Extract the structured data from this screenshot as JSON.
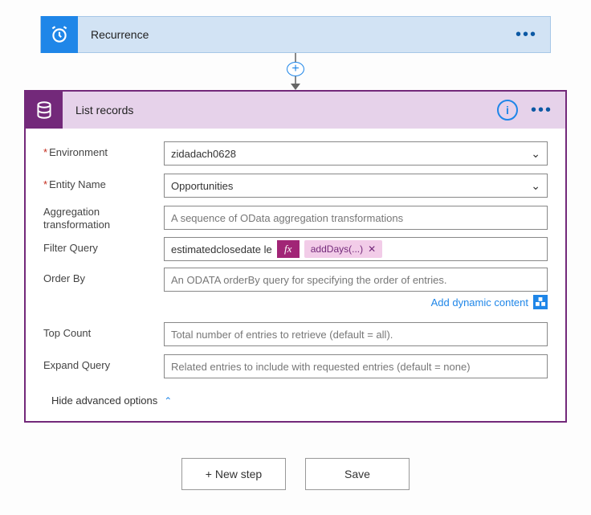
{
  "recurrence": {
    "title": "Recurrence"
  },
  "listRecords": {
    "title": "List records",
    "fields": {
      "environment": {
        "label": "Environment",
        "value": "zidadach0628"
      },
      "entityName": {
        "label": "Entity Name",
        "value": "Opportunities"
      },
      "aggregation": {
        "label": "Aggregation transformation",
        "placeholder": "A sequence of OData aggregation transformations"
      },
      "filterQuery": {
        "label": "Filter Query",
        "pretext": "estimatedclosedate le",
        "fx": "fx",
        "token": "addDays(...)"
      },
      "orderBy": {
        "label": "Order By",
        "placeholder": "An ODATA orderBy query for specifying the order of entries."
      },
      "topCount": {
        "label": "Top Count",
        "placeholder": "Total number of entries to retrieve (default = all)."
      },
      "expandQuery": {
        "label": "Expand Query",
        "placeholder": "Related entries to include with requested entries (default = none)"
      }
    },
    "dynamicContent": "Add dynamic content",
    "hideAdvanced": "Hide advanced options"
  },
  "buttons": {
    "newStep": "+ New step",
    "save": "Save"
  }
}
